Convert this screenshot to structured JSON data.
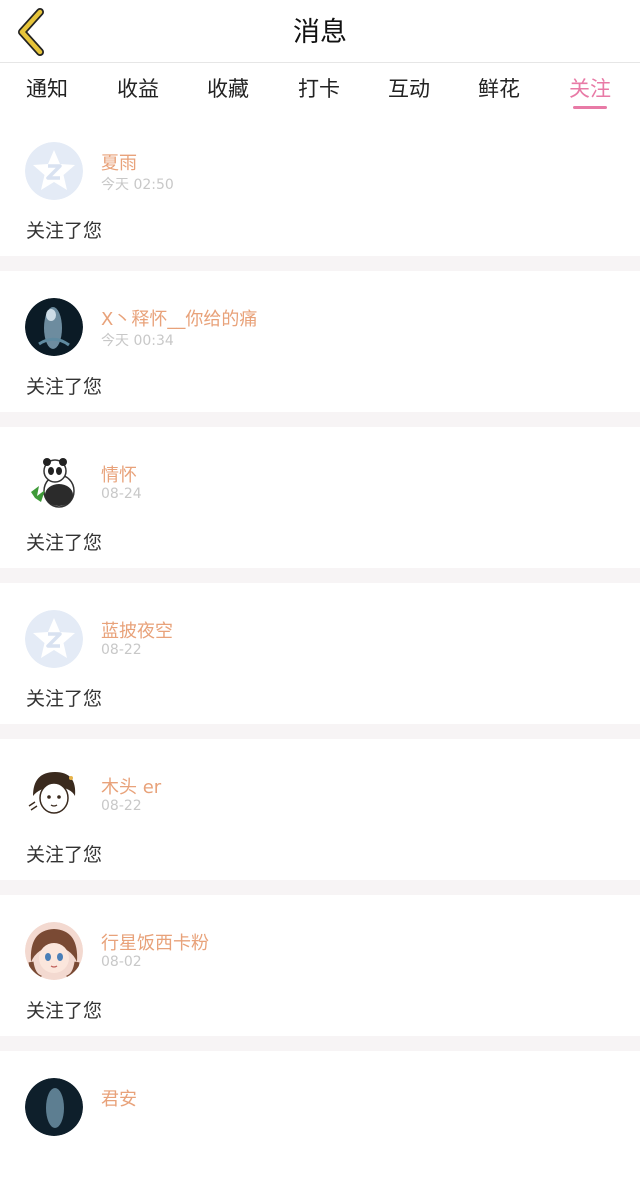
{
  "header": {
    "title": "消息",
    "back_icon": "chevron-left-icon",
    "back_color": "#e6c43a"
  },
  "tabs": [
    {
      "label": "通知"
    },
    {
      "label": "收益"
    },
    {
      "label": "收藏"
    },
    {
      "label": "打卡"
    },
    {
      "label": "互动"
    },
    {
      "label": "鲜花"
    },
    {
      "label": "关注",
      "active": true
    }
  ],
  "accent_color": "#e87aa6",
  "name_color": "#e8a27a",
  "items": [
    {
      "name": "夏雨",
      "time": "今天 02:50",
      "message": "关注了您",
      "avatar": "default-avatar-icon"
    },
    {
      "name": "X丶释怀__你给的痛",
      "time": "今天 00:34",
      "message": "关注了您",
      "avatar": "user-avatar"
    },
    {
      "name": "情怀",
      "time": "08-24",
      "message": "关注了您",
      "avatar": "panda-avatar"
    },
    {
      "name": "蓝披夜空",
      "time": "08-22",
      "message": "关注了您",
      "avatar": "default-avatar-icon"
    },
    {
      "name": "木头 er",
      "time": "08-22",
      "message": "关注了您",
      "avatar": "sketch-girl-avatar"
    },
    {
      "name": "行星饭西卡粉",
      "time": "08-02",
      "message": "关注了您",
      "avatar": "anime-girl-avatar"
    },
    {
      "name": "君安",
      "avatar": "user-avatar"
    }
  ]
}
